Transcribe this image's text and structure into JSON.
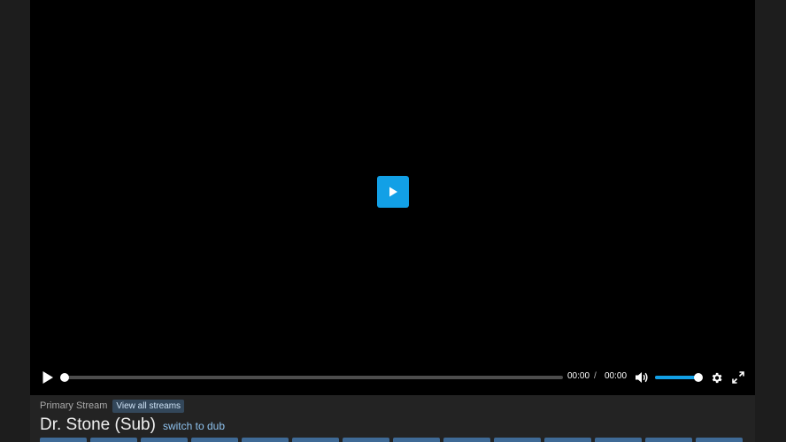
{
  "player": {
    "current_time": "00:00",
    "separator": "/",
    "total_time": "00:00",
    "progress": 0,
    "volume": 1.0,
    "accent_color": "#12a0e6"
  },
  "icons": {
    "big_play": "play-icon",
    "play": "play-icon",
    "volume": "volume-icon",
    "settings": "gear-icon",
    "fullscreen": "fullscreen-icon"
  },
  "stream": {
    "label": "Primary Stream",
    "view_all_label": "View all streams"
  },
  "show": {
    "title": "Dr. Stone (Sub)",
    "switch_label": "switch to dub"
  },
  "episode_buttons": 14
}
